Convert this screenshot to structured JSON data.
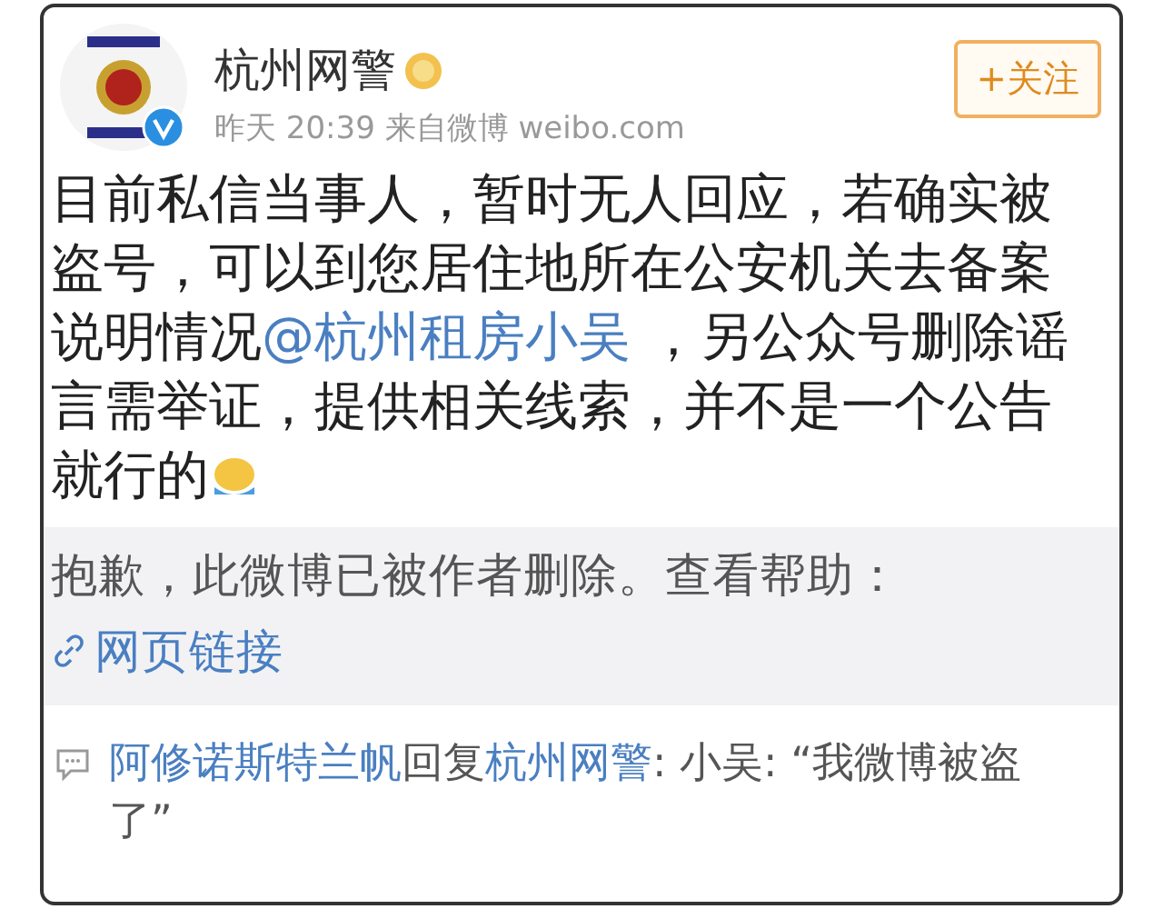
{
  "post": {
    "author": "杭州网警",
    "verified": true,
    "time": "昨天 20:39",
    "source": "来自微博 weibo.com",
    "follow_button": "+关注",
    "body": [
      {
        "kind": "text",
        "text": "目前私信当事人，暂时无人回应，若确实被盗号，可以到您居住地所在公安机关去备案说明情况"
      },
      {
        "kind": "mention",
        "text": "@杭州租房小吴"
      },
      {
        "kind": "text",
        "text": " ，另公众号删除谣言需举证，提供相关线索，并不是一个公告就行的"
      },
      {
        "kind": "emoji"
      }
    ]
  },
  "deleted_notice": {
    "text": "抱歉，此微博已被作者删除。查看帮助：",
    "link": "网页链接"
  },
  "comment": {
    "user": "阿修诺斯特兰帆",
    "action": "回复",
    "target": "杭州网警",
    "text": ": 小吴: “我微博被盗了”"
  }
}
